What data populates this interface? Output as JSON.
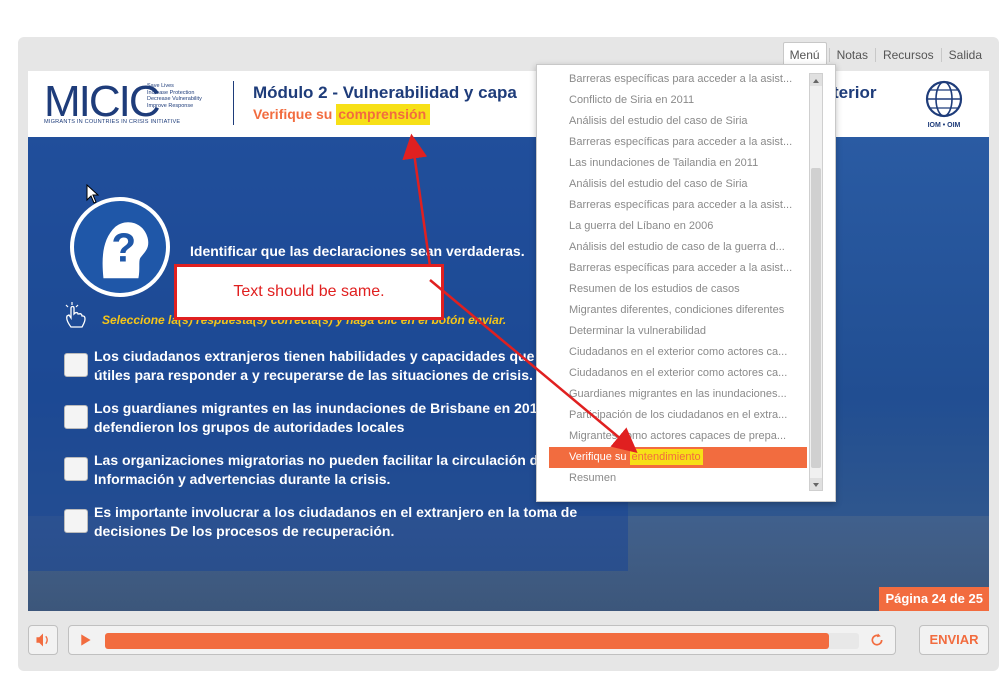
{
  "nav": {
    "items": [
      {
        "label": "Menú",
        "active": true
      },
      {
        "label": "Notas",
        "active": false
      },
      {
        "label": "Recursos",
        "active": false
      },
      {
        "label": "Salida",
        "active": false
      }
    ]
  },
  "header": {
    "logo_word": "MICIC",
    "logo_taglines": [
      "Save Lives",
      "Increase Protection",
      "Decrease Vulnerability",
      "Improve Response"
    ],
    "logo_sub": "MIGRANTS IN COUNTRIES IN CRISIS INITIATIVE",
    "title": "Módulo 2 - Vulnerabilidad y capa",
    "title_suffix": "terior",
    "subtitle_prefix": "Verifique su ",
    "subtitle_highlight": "comprensión",
    "partner_logo": "IOM • OIM"
  },
  "question": {
    "prompt": "Identificar que las declaraciones sean verdaderas.",
    "instruction": "Seleccione la(s) respuesta(s) correcta(s) y haga clic en el botón enviar.",
    "options": [
      {
        "text": "Los ciudadanos extranjeros tienen habilidades y capacidades que pueden ser útiles para responder a y recuperarse de las situaciones de crisis.",
        "checked": false
      },
      {
        "text": "Los guardianes migrantes en las inundaciones de Brisbane en 2011 defendieron los grupos de autoridades locales",
        "checked": false
      },
      {
        "text": "Las organizaciones migratorias no pueden facilitar la circulación de Información y advertencias durante la crisis.",
        "checked": false
      },
      {
        "text": "Es importante involucrar a los ciudadanos en el extranjero en la toma de decisiones De los procesos de recuperación.",
        "checked": false
      }
    ]
  },
  "page_indicator": "Página 24 de 25",
  "controls": {
    "submit_label": "ENVIAR",
    "progress_fraction": 0.96
  },
  "menu": {
    "items": [
      "Barreras específicas para acceder a la asist...",
      "Conflicto de Siria en 2011",
      "Análisis del estudio del caso de Siria",
      "Barreras específicas para acceder a la asist...",
      "Las inundaciones de Tailandia en 2011",
      "Análisis del estudio del caso de Siria",
      "Barreras específicas para acceder a la asist...",
      "La guerra del Líbano en 2006",
      "Análisis del estudio de caso de la guerra d...",
      "Barreras específicas para acceder a la asist...",
      "Resumen de los estudios de casos",
      "Migrantes diferentes, condiciones diferentes",
      "Determinar la vulnerabilidad",
      "Ciudadanos en el exterior como actores ca...",
      "Ciudadanos en el exterior como actores ca...",
      "Guardianes migrantes en las inundaciones...",
      "Participación de los ciudadanos en el extra...",
      "Migrantes como actores capaces de prepa...",
      "Verifique su entendimiento",
      "Resumen"
    ],
    "active_prefix": "Verifique su ",
    "active_highlight": "entendimiento",
    "active_index": 18
  },
  "annotation": {
    "callout_text": "Text should be same."
  },
  "colors": {
    "accent": "#f26c3f",
    "highlight": "#f7e017",
    "brand_blue": "#1e3c7a",
    "annotation_red": "#e02020"
  }
}
